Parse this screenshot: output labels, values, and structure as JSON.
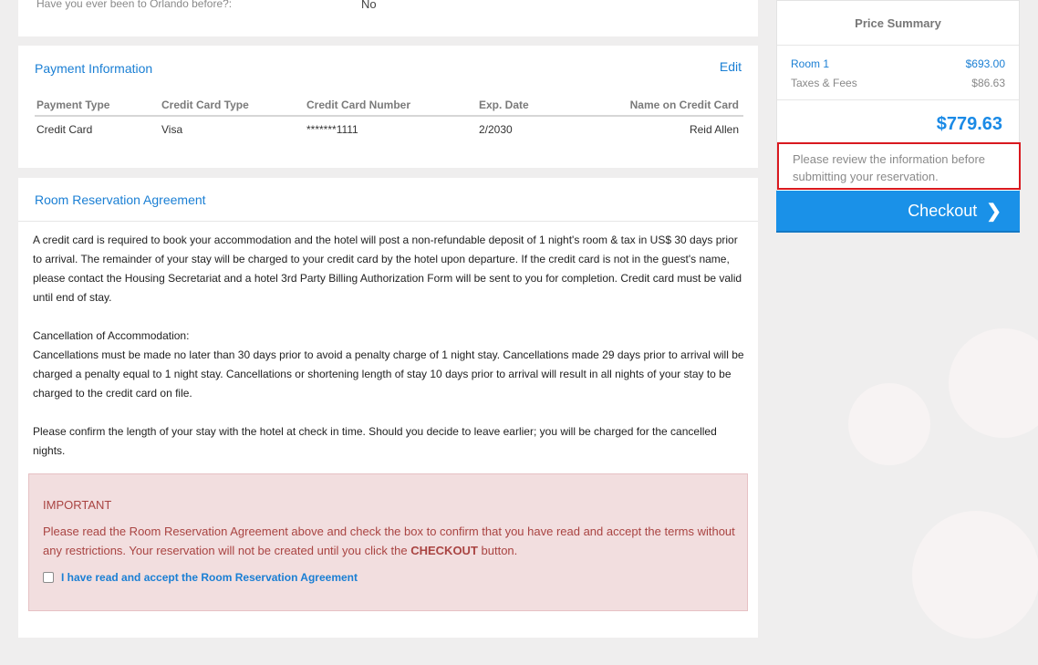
{
  "previous_section": {
    "question": "Have you ever been to Orlando before?:",
    "answer": "No"
  },
  "payment": {
    "title": "Payment Information",
    "edit_label": "Edit",
    "headers": [
      "Payment Type",
      "Credit Card Type",
      "Credit Card Number",
      "Exp. Date",
      "Name on Credit Card"
    ],
    "row": [
      "Credit Card",
      "Visa",
      "*******1111",
      "2/2030",
      "Reid Allen"
    ]
  },
  "agreement": {
    "title": "Room Reservation Agreement",
    "paragraphs": [
      "A credit card is required to book your accommodation and the hotel will post a non-refundable deposit of 1 night's room & tax in US$ 30 days prior to arrival. The remainder of your stay will be charged to your credit card by the hotel upon departure.  If the credit card is not in the guest's name, please contact the Housing Secretariat and a hotel 3rd Party Billing Authorization Form will be sent to you for completion.  Credit card must be valid until end of stay.",
      "Cancellation of Accommodation:",
      "Cancellations must be made no later than 30 days prior to avoid a penalty charge of 1 night stay. Cancellations made 29 days prior to arrival will be charged a penalty equal to 1 night stay. Cancellations or shortening length of stay 10 days prior to arrival will result in all nights of your stay to be charged to the credit card on file.",
      "Please confirm the length of your stay with the hotel at check in time. Should you decide to leave earlier; you will be charged for the cancelled nights."
    ],
    "important_title": "IMPORTANT",
    "important_text": "Please read the Room Reservation Agreement above and check the box to confirm that you have read and accept the terms without any restrictions.  Your reservation will not be created until you click the",
    "important_emphasis": "CHECKOUT",
    "important_suffix": "button.",
    "checkbox_label": "I have read and accept the Room Reservation Agreement",
    "checkbox_checked": false
  },
  "price_summary": {
    "title": "Price Summary",
    "room_label": "Room 1",
    "room_price": "$693.00",
    "taxes_label": "Taxes & Fees",
    "taxes_price": "$86.63",
    "total": "$779.63",
    "notice": "Please review the information before submitting your reservation.",
    "checkout_label": "Checkout"
  },
  "colors": {
    "accent": "#1a7fd4",
    "checkout_button": "#1a91e8",
    "important_bg": "#f2dedf",
    "important_text": "#a94442",
    "notice_border": "#d9191f"
  }
}
